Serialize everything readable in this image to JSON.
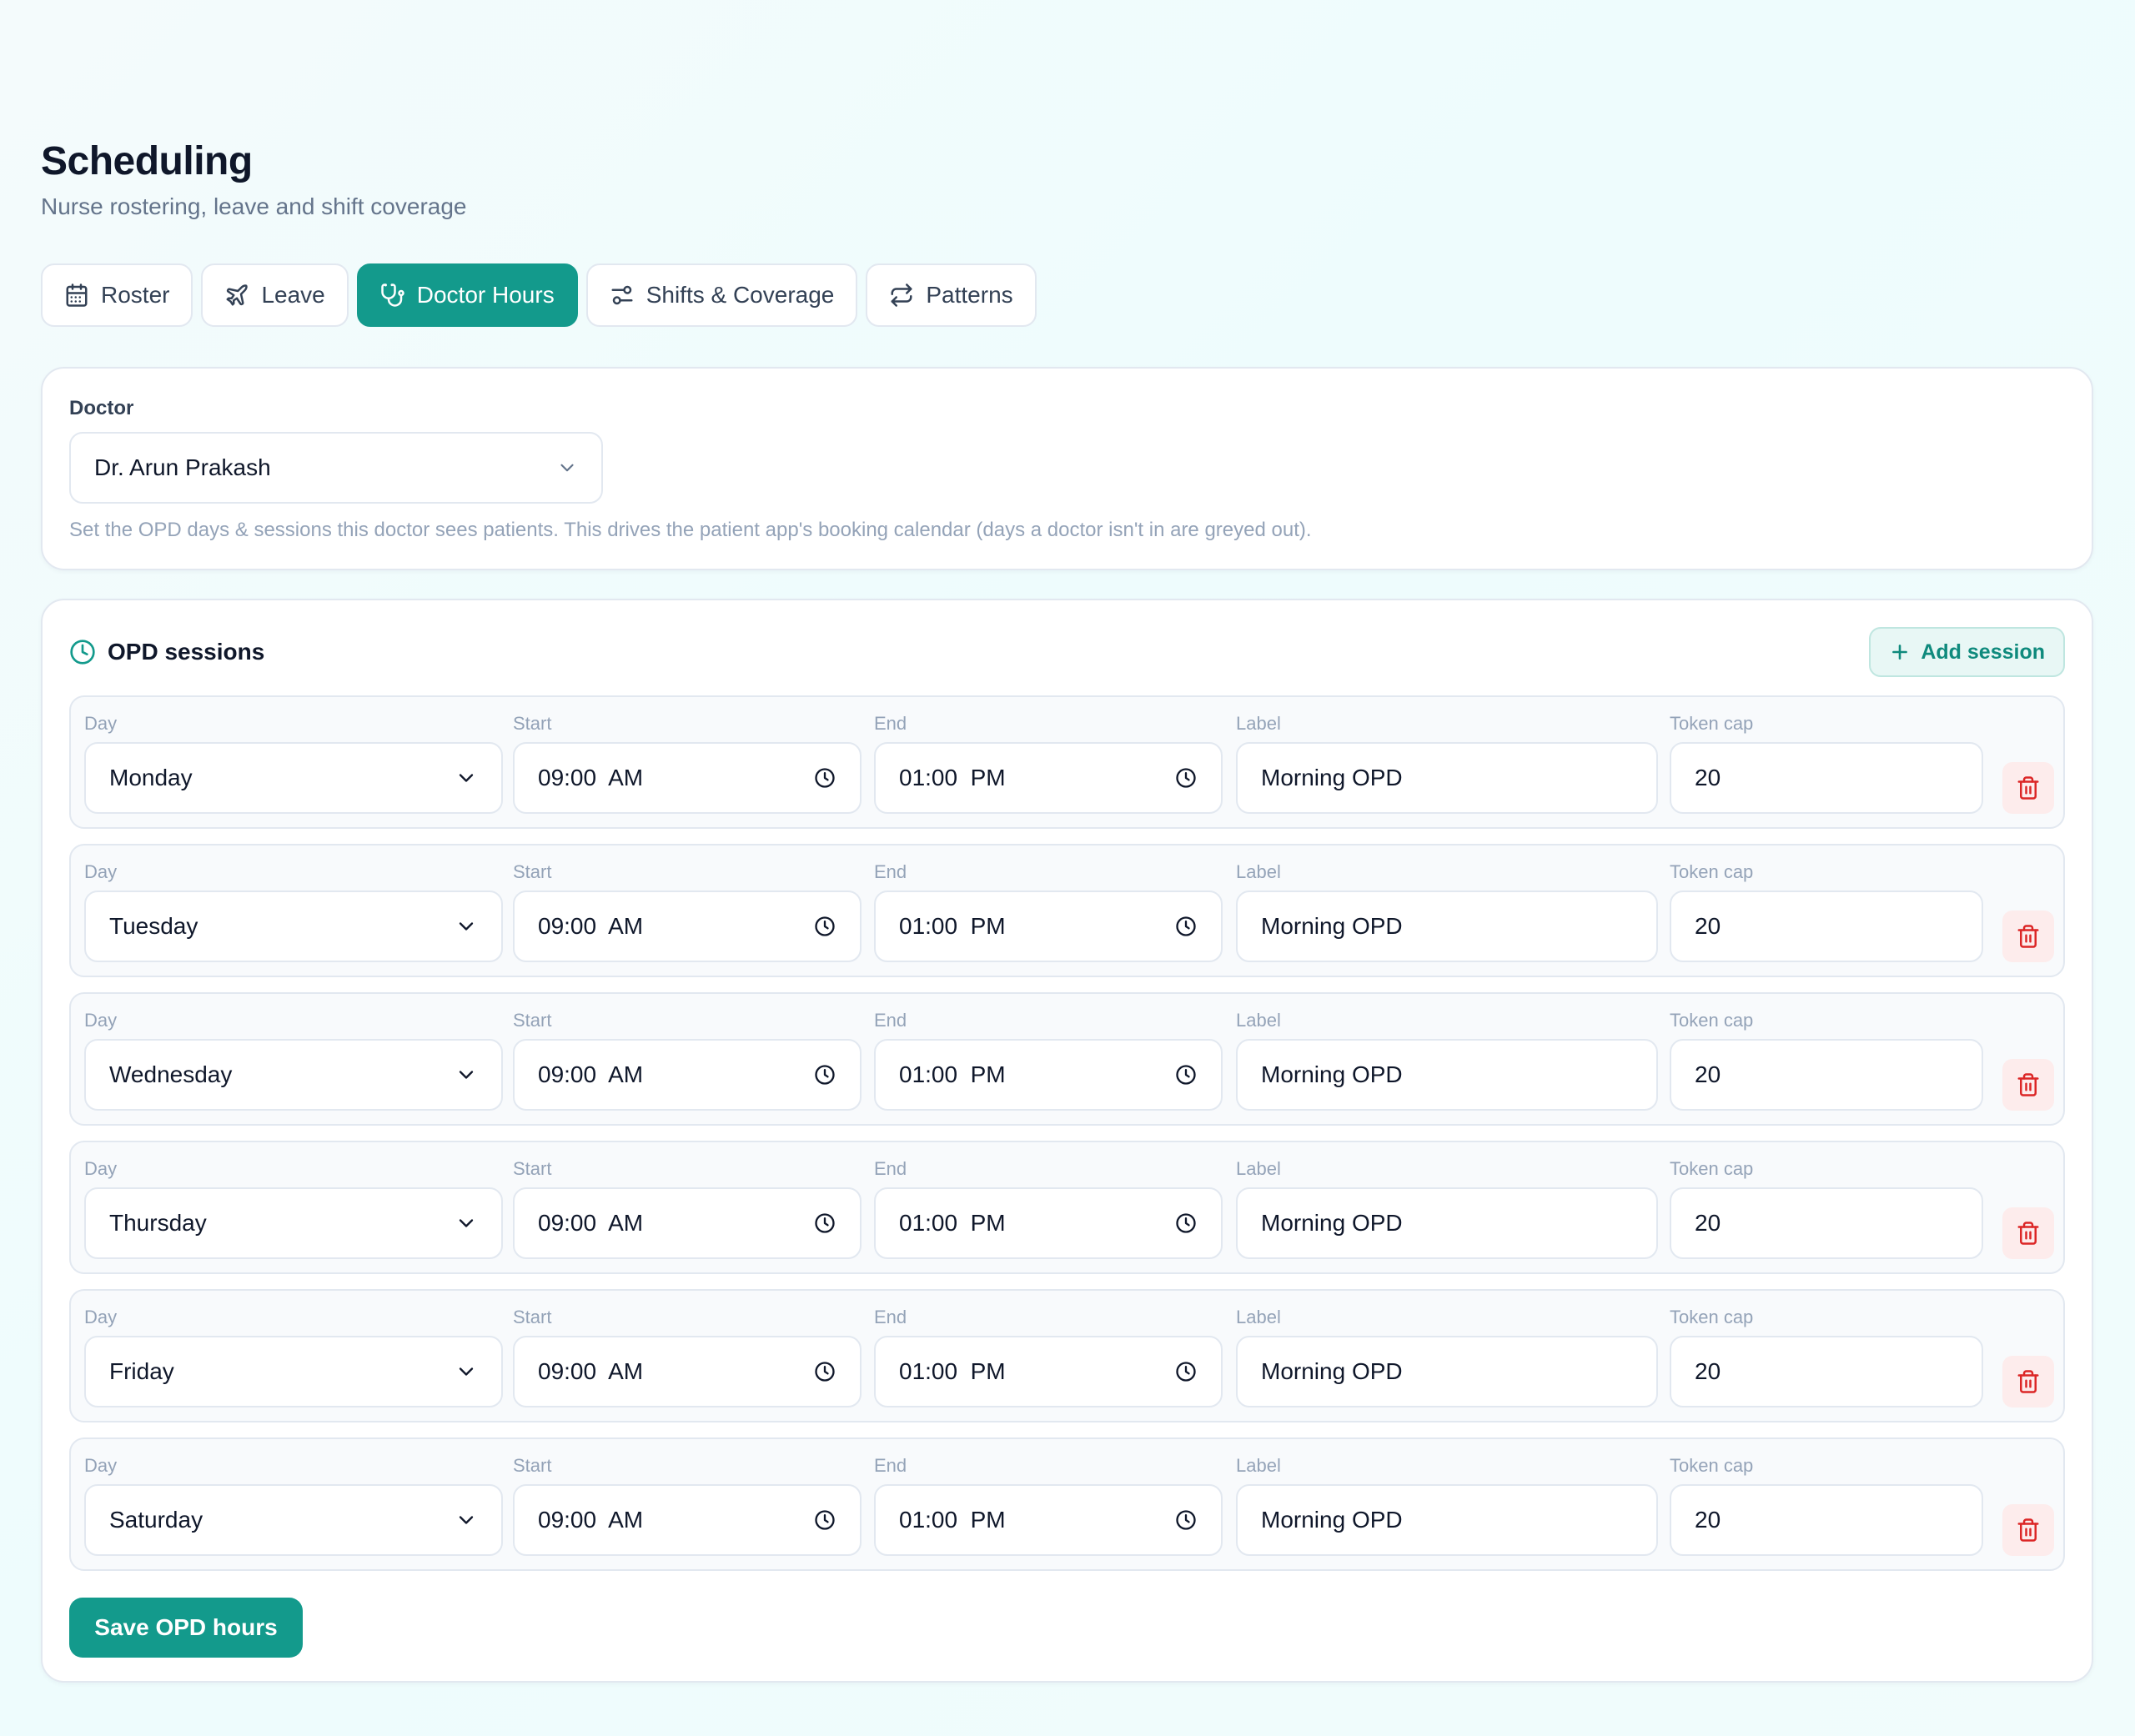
{
  "header": {
    "title": "Scheduling",
    "subtitle": "Nurse rostering, leave and shift coverage"
  },
  "tabs": [
    {
      "label": "Roster",
      "icon": "calendar-icon",
      "active": false
    },
    {
      "label": "Leave",
      "icon": "plane-icon",
      "active": false
    },
    {
      "label": "Doctor Hours",
      "icon": "stethoscope-icon",
      "active": true
    },
    {
      "label": "Shifts & Coverage",
      "icon": "sliders-icon",
      "active": false
    },
    {
      "label": "Patterns",
      "icon": "repeat-icon",
      "active": false
    }
  ],
  "doctor": {
    "label": "Doctor",
    "selected": "Dr. Arun Prakash",
    "hint": "Set the OPD days & sessions this doctor sees patients. This drives the patient app's booking calendar (days a doctor isn't in are greyed out)."
  },
  "sessions": {
    "title": "OPD sessions",
    "add_label": "Add session",
    "column_labels": {
      "day": "Day",
      "start": "Start",
      "end": "End",
      "label": "Label",
      "token_cap": "Token cap"
    },
    "rows": [
      {
        "day": "Monday",
        "start": "09:00  AM",
        "end": "01:00  PM",
        "label": "Morning OPD",
        "token_cap": "20"
      },
      {
        "day": "Tuesday",
        "start": "09:00  AM",
        "end": "01:00  PM",
        "label": "Morning OPD",
        "token_cap": "20"
      },
      {
        "day": "Wednesday",
        "start": "09:00  AM",
        "end": "01:00  PM",
        "label": "Morning OPD",
        "token_cap": "20"
      },
      {
        "day": "Thursday",
        "start": "09:00  AM",
        "end": "01:00  PM",
        "label": "Morning OPD",
        "token_cap": "20"
      },
      {
        "day": "Friday",
        "start": "09:00  AM",
        "end": "01:00  PM",
        "label": "Morning OPD",
        "token_cap": "20"
      },
      {
        "day": "Saturday",
        "start": "09:00  AM",
        "end": "01:00  PM",
        "label": "Morning OPD",
        "token_cap": "20"
      }
    ],
    "save_label": "Save OPD hours"
  },
  "colors": {
    "accent": "#139a8c",
    "danger": "#dc2626",
    "muted": "#94a3b8"
  }
}
